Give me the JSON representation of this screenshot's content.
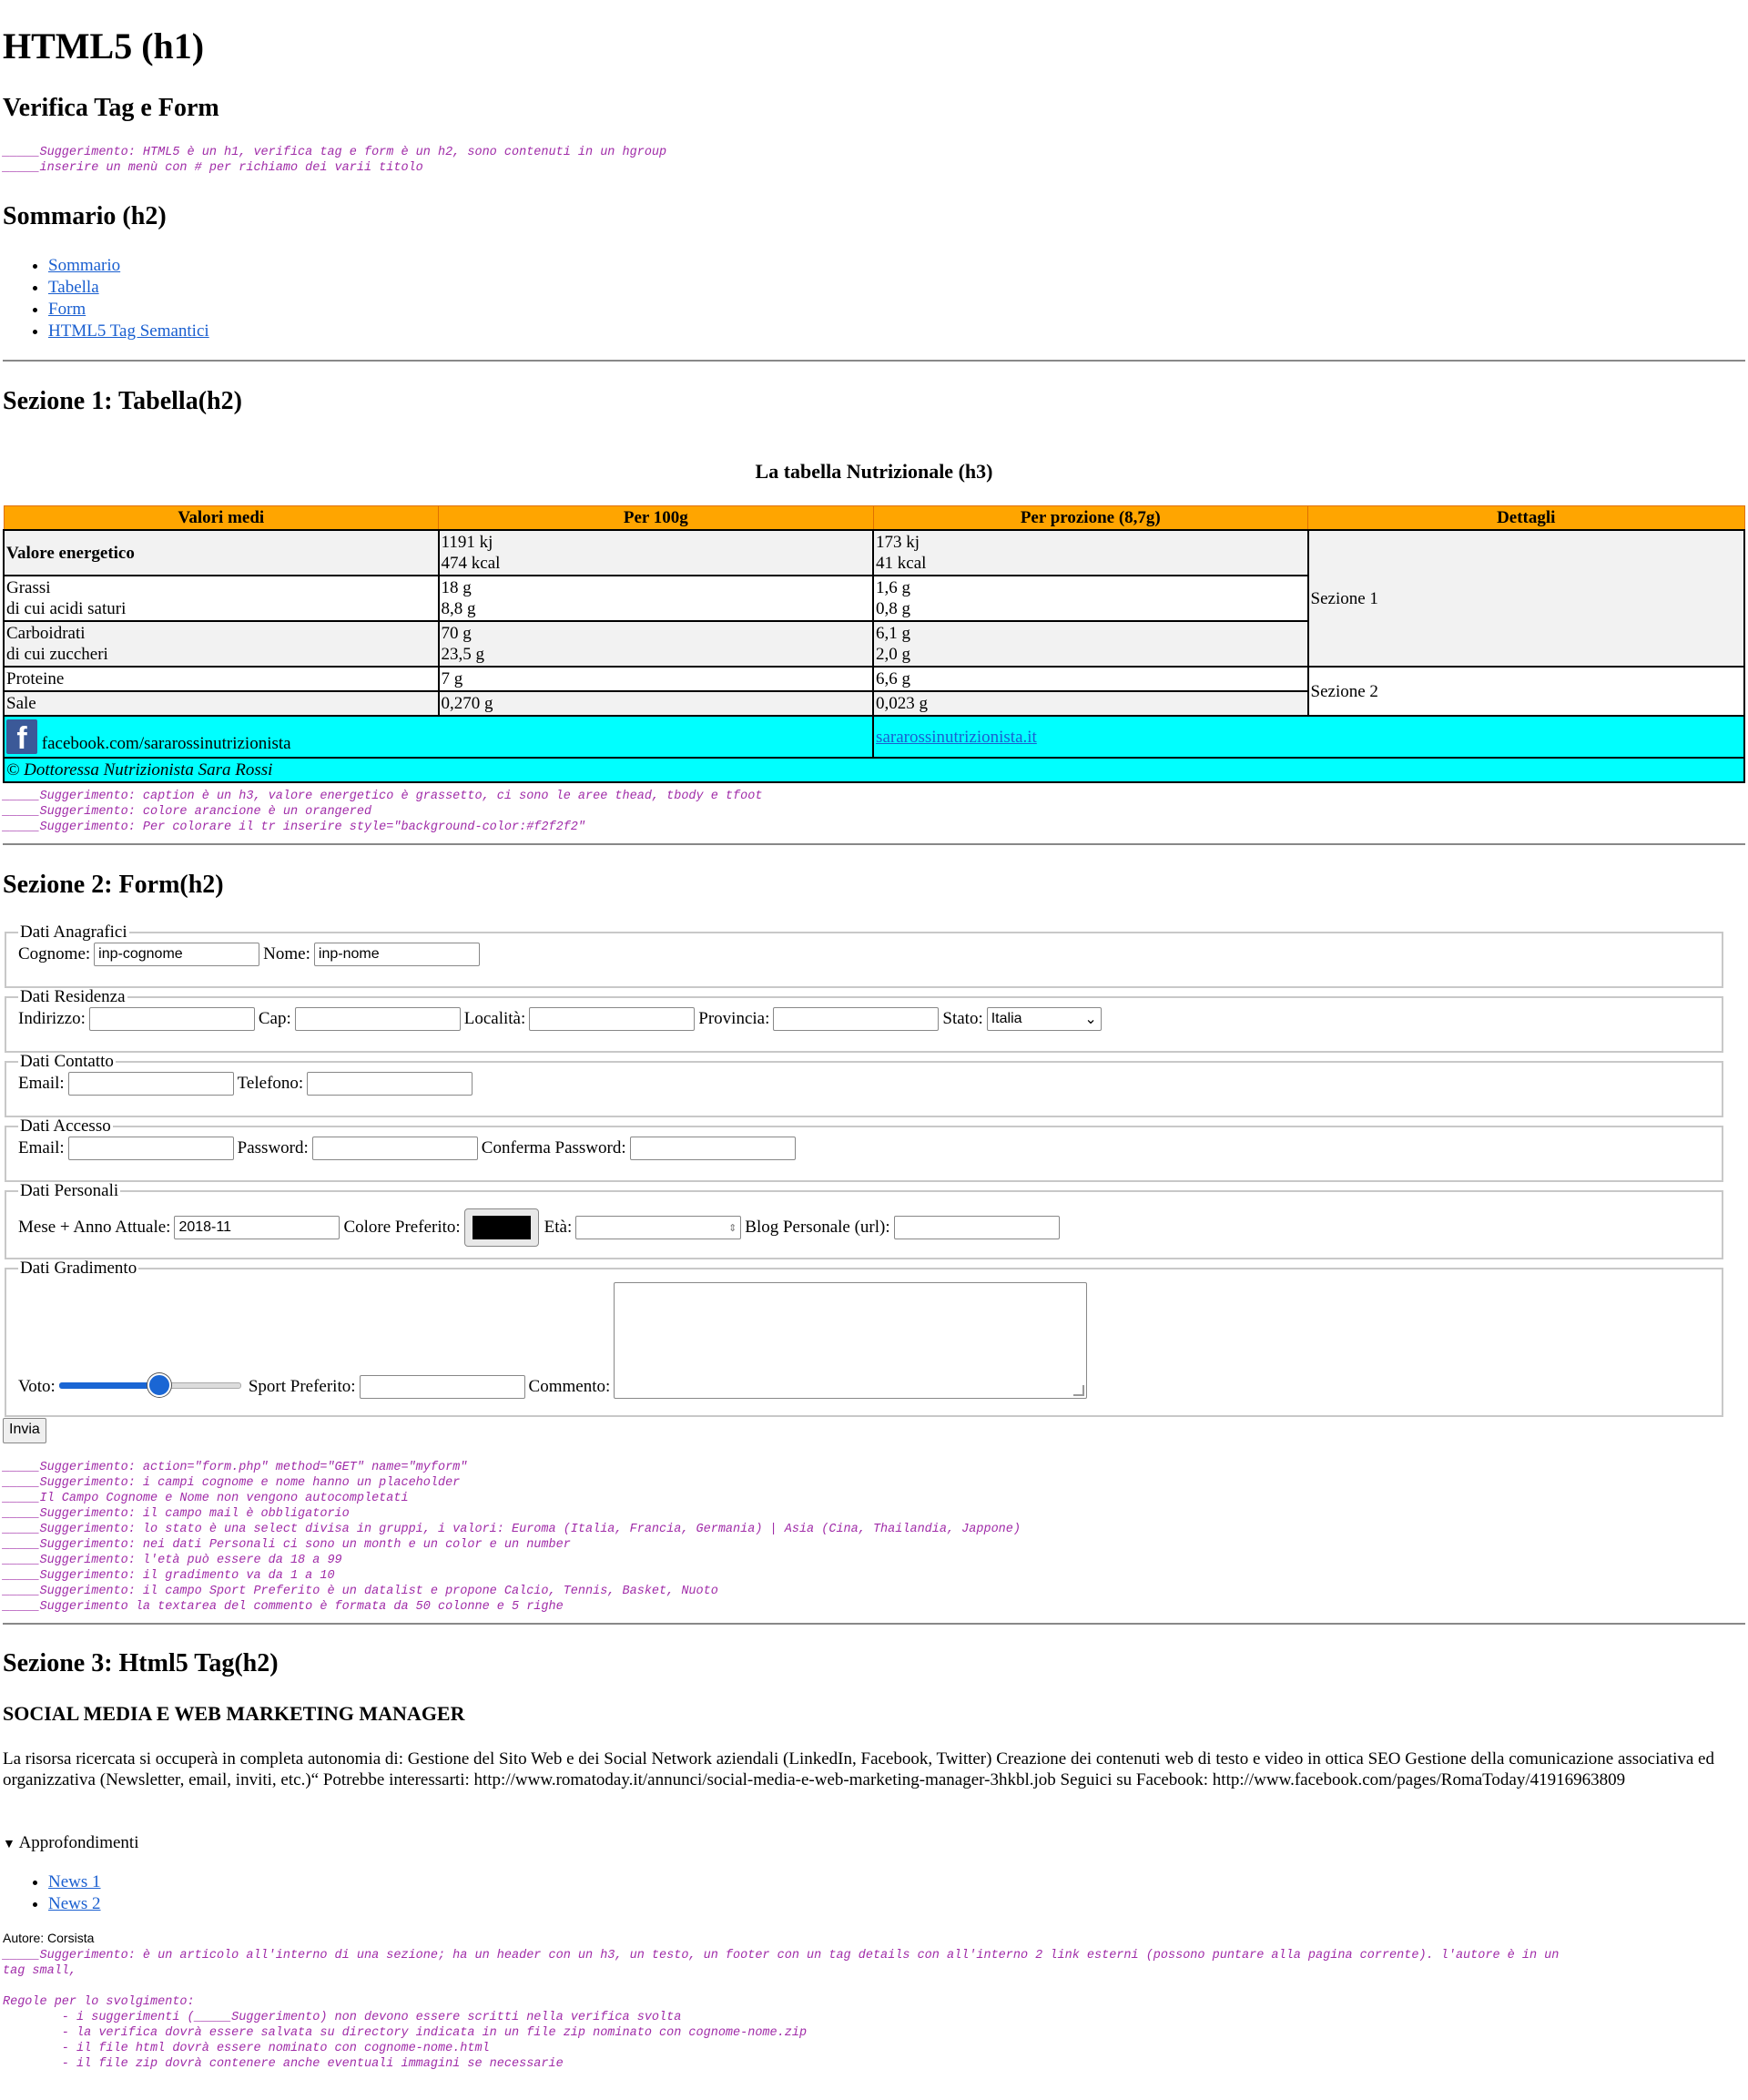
{
  "header": {
    "title": "HTML5 (h1)",
    "subtitle": "Verifica Tag e Form",
    "hints": [
      "_____Suggerimento: HTML5 è un h1, verifica tag e form è un h2, sono contenuti in un hgroup",
      "_____inserire un menù con # per richiamo dei varii titolo"
    ]
  },
  "summary": {
    "title": "Sommario (h2)",
    "links": [
      "Sommario",
      "Tabella",
      "Form",
      "HTML5 Tag Semantici"
    ]
  },
  "section1": {
    "title": "Sezione 1: Tabella(h2)",
    "caption": "La tabella Nutrizionale (h3)",
    "headers": [
      "Valori medi",
      "Per 100g",
      "Per prozione (8,7g)",
      "Dettagli"
    ],
    "rows": {
      "energy": {
        "label": "Valore energetico",
        "per100_1": "1191 kj",
        "per100_2": "474 kcal",
        "perp_1": "173 kj",
        "perp_2": "41 kcal"
      },
      "fat": {
        "label1": "Grassi",
        "label2": "di cui acidi saturi",
        "per100_1": "18 g",
        "per100_2": "8,8 g",
        "perp_1": "1,6 g",
        "perp_2": "0,8 g"
      },
      "carbs": {
        "label1": "Carboidrati",
        "label2": "di cui zuccheri",
        "per100_1": "70 g",
        "per100_2": "23,5 g",
        "perp_1": "6,1 g",
        "perp_2": "2,0 g"
      },
      "protein": {
        "label": "Proteine",
        "per100": "7 g",
        "perp": "6,6 g"
      },
      "salt": {
        "label": "Sale",
        "per100": "0,270 g",
        "perp": "0,023 g"
      }
    },
    "details": {
      "sec1": "Sezione 1",
      "sec2": "Sezione 2"
    },
    "footer": {
      "facebook": "facebook.com/sararossinutrizionista",
      "website": "sararossinutrizionista.it",
      "copyright": "© Dottoressa Nutrizionista Sara Rossi"
    },
    "hints": [
      "_____Suggerimento: caption è un h3, valore energetico è grassetto, ci sono le aree thead, tbody e tfoot",
      "_____Suggerimento: colore arancione è un orangered",
      "_____Suggerimento: Per colorare il tr inserire style=\"background-color:#f2f2f2\""
    ],
    "colors": {
      "header_bg": "#ffa500",
      "row_grey": "#f2f2f2",
      "footer_bg": "#00ffff"
    }
  },
  "section2": {
    "title": "Sezione 2: Form(h2)",
    "anagrafici": {
      "legend": "Dati Anagrafici",
      "cognome_label": "Cognome:",
      "cognome_value": "inp-cognome",
      "nome_label": "Nome:",
      "nome_value": "inp-nome"
    },
    "residenza": {
      "legend": "Dati Residenza",
      "indirizzo": "Indirizzo:",
      "cap": "Cap:",
      "localita": "Località:",
      "provincia": "Provincia:",
      "stato": "Stato:",
      "stato_value": "Italia"
    },
    "contatto": {
      "legend": "Dati Contatto",
      "email": "Email:",
      "telefono": "Telefono:"
    },
    "accesso": {
      "legend": "Dati Accesso",
      "email": "Email:",
      "password": "Password:",
      "conferma": "Conferma Password:"
    },
    "personali": {
      "legend": "Dati Personali",
      "mese": "Mese + Anno Attuale:",
      "mese_value": "2018-11",
      "colore": "Colore Preferito:",
      "colore_value": "#000000",
      "eta": "Età:",
      "blog": "Blog Personale (url):"
    },
    "gradimento": {
      "legend": "Dati Gradimento",
      "voto": "Voto:",
      "voto_value": 0.55,
      "sport": "Sport Preferito:",
      "commento": "Commento:"
    },
    "submit": "Invia",
    "hints": [
      "_____Suggerimento: action=\"form.php\" method=\"GET\" name=\"myform\"",
      "_____Suggerimento: i campi cognome e nome hanno un placeholder",
      "_____Il Campo Cognome e Nome non vengono autocompletati",
      "_____Suggerimento: il campo mail è obbligatorio",
      "_____Suggerimento: lo stato è una select divisa in gruppi, i valori: Euroma (Italia, Francia, Germania) | Asia (Cina, Thailandia, Jappone)",
      "_____Suggerimento: nei dati Personali ci sono un month e un color e un number",
      "_____Suggerimento: l'età può essere da 18 a 99",
      "_____Suggerimento: il gradimento va da 1 a 10",
      "_____Suggerimento: il campo Sport Preferito è un datalist e propone Calcio, Tennis, Basket, Nuoto",
      "_____Suggerimento la textarea del commento è formata da 50 colonne e 5 righe"
    ]
  },
  "section3": {
    "title": "Sezione 3: Html5 Tag(h2)",
    "job_title": "SOCIAL MEDIA E WEB MARKETING MANAGER",
    "text": "La risorsa ricercata si occuperà in completa autonomia di: Gestione del Sito Web e dei Social Network aziendali (LinkedIn, Facebook, Twitter) Creazione dei contenuti web di testo e video in ottica SEO Gestione della comunicazione associativa ed organizzativa (Newsletter, email, inviti, etc.)“ Potrebbe interessarti: http://www.romatoday.it/annunci/social-media-e-web-marketing-manager-3hkbl.job Seguici su Facebook: http://www.facebook.com/pages/RomaToday/41916963809",
    "details_summary": "Approfondimenti",
    "news": [
      "News 1",
      "News 2"
    ],
    "author": "Autore: Corsista",
    "hints": [
      "_____Suggerimento: è un articolo all'interno di una sezione; ha un header con un h3, un testo, un footer con un tag details con all'interno 2 link esterni (possono puntare alla pagina corrente). l'autore è in un",
      "tag small,",
      "",
      "Regole per lo svolgimento:",
      "        - i suggerimenti (_____Suggerimento) non devono essere scritti nella verifica svolta",
      "        - la verifica dovrà essere salvata su directory indicata in un file zip nominato con cognome-nome.zip",
      "        - il file html dovrà essere nominato con cognome-nome.html",
      "        - il file zip dovrà contenere anche eventuali immagini se necessarie"
    ]
  }
}
